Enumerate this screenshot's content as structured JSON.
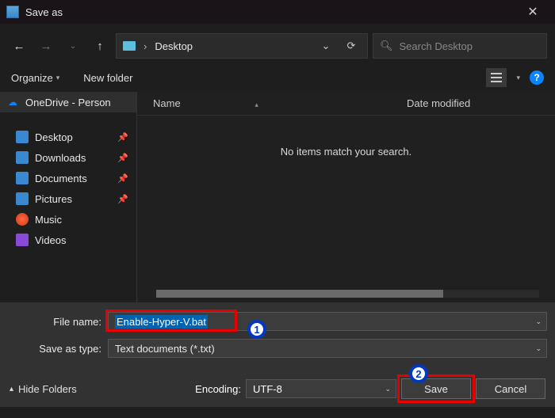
{
  "titlebar": {
    "title": "Save as"
  },
  "nav": {
    "location_folder": "Desktop",
    "search_placeholder": "Search Desktop"
  },
  "toolbar": {
    "organize": "Organize",
    "new_folder": "New folder"
  },
  "sidebar": {
    "root": "OneDrive - Person",
    "items": [
      {
        "label": "Desktop"
      },
      {
        "label": "Downloads"
      },
      {
        "label": "Documents"
      },
      {
        "label": "Pictures"
      },
      {
        "label": "Music"
      },
      {
        "label": "Videos"
      }
    ]
  },
  "filelist": {
    "col_name": "Name",
    "col_date": "Date modified",
    "empty_message": "No items match your search."
  },
  "form": {
    "filename_label": "File name:",
    "filename_value": "Enable-Hyper-V.bat",
    "saveastype_label": "Save as type:",
    "saveastype_value": "Text documents (*.txt)",
    "encoding_label": "Encoding:",
    "encoding_value": "UTF-8"
  },
  "footer": {
    "hide_folders": "Hide Folders",
    "save": "Save",
    "cancel": "Cancel"
  },
  "annotations": {
    "badge1": "1",
    "badge2": "2"
  }
}
